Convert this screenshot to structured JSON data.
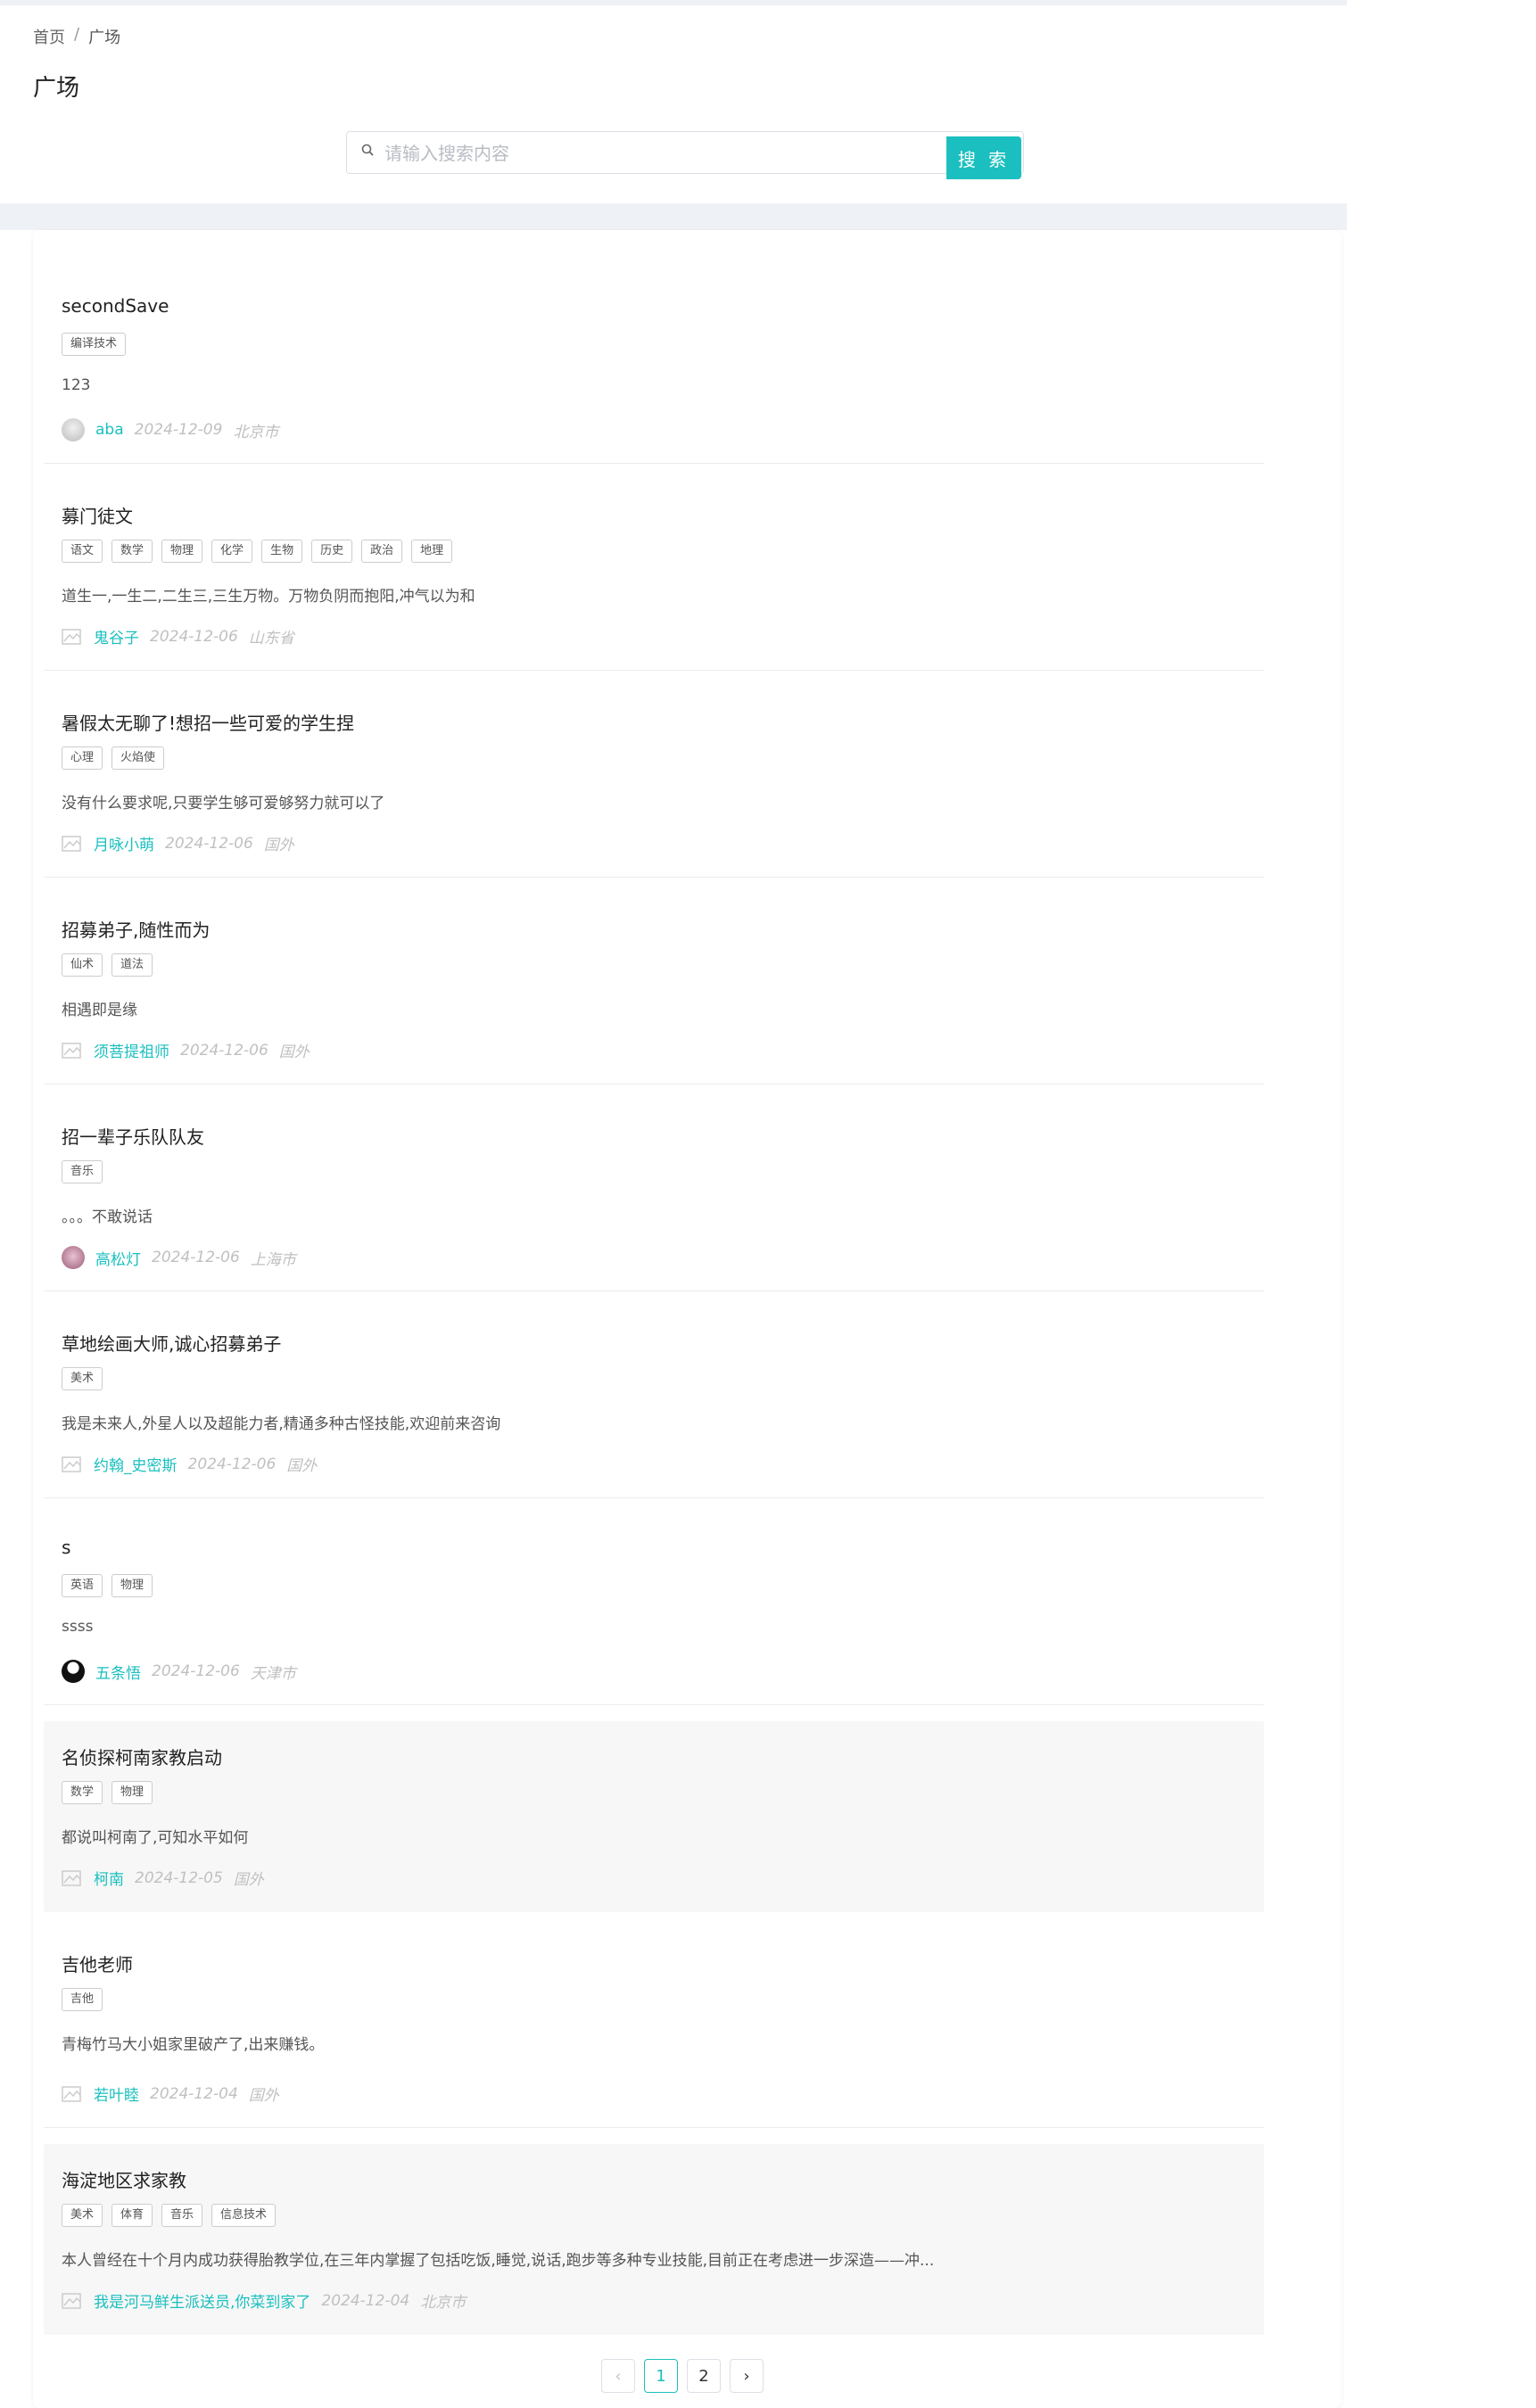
{
  "breadcrumb": {
    "home": "首页",
    "separator": "/",
    "current": "广场"
  },
  "page_title": "广场",
  "search": {
    "placeholder": "请输入搜索内容",
    "button_label": "搜 索"
  },
  "colors": {
    "accent": "#1bbfbf",
    "background": "#eef1f5"
  },
  "posts": [
    {
      "title": "secondSave",
      "tags": [
        "编译技术"
      ],
      "desc": "123",
      "author": "aba",
      "date": "2024-12-09",
      "location": "北京市",
      "avatar": "photo"
    },
    {
      "title": "募门徒文",
      "tags": [
        "语文",
        "数学",
        "物理",
        "化学",
        "生物",
        "历史",
        "政治",
        "地理"
      ],
      "desc": "道生一,一生二,二生三,三生万物。万物负阴而抱阳,冲气以为和",
      "author": "鬼谷子",
      "date": "2024-12-06",
      "location": "山东省",
      "avatar": "broken-image-icon"
    },
    {
      "title": "暑假太无聊了!想招一些可爱的学生捏",
      "tags": [
        "心理",
        "火焰使"
      ],
      "desc": "没有什么要求呢,只要学生够可爱够努力就可以了",
      "author": "月咏小萌",
      "date": "2024-12-06",
      "location": "国外",
      "avatar": "broken-image-icon"
    },
    {
      "title": "招募弟子,随性而为",
      "tags": [
        "仙术",
        "道法"
      ],
      "desc": "相遇即是缘",
      "author": "须菩提祖师",
      "date": "2024-12-06",
      "location": "国外",
      "avatar": "broken-image-icon"
    },
    {
      "title": "招一辈子乐队队友",
      "tags": [
        "音乐"
      ],
      "desc": "。。。不敢说话",
      "author": "高松灯",
      "date": "2024-12-06",
      "location": "上海市",
      "avatar": "photo"
    },
    {
      "title": "草地绘画大师,诚心招募弟子",
      "tags": [
        "美术"
      ],
      "desc": "我是未来人,外星人以及超能力者,精通多种古怪技能,欢迎前来咨询",
      "author": "约翰_史密斯",
      "date": "2024-12-06",
      "location": "国外",
      "avatar": "broken-image-icon"
    },
    {
      "title": "s",
      "tags": [
        "英语",
        "物理"
      ],
      "desc": "ssss",
      "author": "五条悟",
      "date": "2024-12-06",
      "location": "天津市",
      "avatar": "photo"
    },
    {
      "title": "名侦探柯南家教启动",
      "tags": [
        "数学",
        "物理"
      ],
      "desc": "都说叫柯南了,可知水平如何",
      "author": "柯南",
      "date": "2024-12-05",
      "location": "国外",
      "avatar": "broken-image-icon"
    },
    {
      "title": "吉他老师",
      "tags": [
        "吉他"
      ],
      "desc": "青梅竹马大小姐家里破产了,出来赚钱。",
      "author": "若叶睦",
      "date": "2024-12-04",
      "location": "国外",
      "avatar": "broken-image-icon"
    },
    {
      "title": "海淀地区求家教",
      "tags": [
        "美术",
        "体育",
        "音乐",
        "信息技术"
      ],
      "desc": "本人曾经在十个月内成功获得胎教学位,在三年内掌握了包括吃饭,睡觉,说话,跑步等多种专业技能,目前正在考虑进一步深造——冲...",
      "author": "我是河马鲜生派送员,你菜到家了",
      "date": "2024-12-04",
      "location": "北京市",
      "avatar": "broken-image-icon"
    }
  ],
  "pagination": {
    "prev": "‹",
    "pages": [
      "1",
      "2"
    ],
    "current": "1",
    "next": "›"
  }
}
